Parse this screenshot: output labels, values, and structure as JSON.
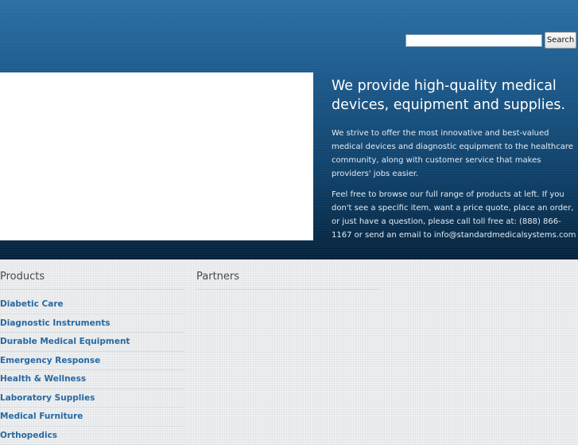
{
  "search": {
    "value": "",
    "button_label": "Search"
  },
  "hero": {
    "headline": "We provide high-quality medical devices, equipment and supplies.",
    "paragraph1": "We strive to offer the most innovative and best-valued medical devices and diagnostic equipment to the healthcare community, along with customer service that makes providers' jobs easier.",
    "paragraph2": "Feel free to browse our full range of products at left. If you don't see a specific item, want a price quote, place an order, or just have a question, please call toll free at: (888) 866-1167 or send an email to info@standardmedicalsystems.com"
  },
  "products": {
    "title": "Products",
    "items": [
      {
        "label": "Diabetic Care"
      },
      {
        "label": "Diagnostic Instruments"
      },
      {
        "label": "Durable Medical Equipment"
      },
      {
        "label": "Emergency Response"
      },
      {
        "label": "Health & Wellness"
      },
      {
        "label": "Laboratory Supplies"
      },
      {
        "label": "Medical Furniture"
      },
      {
        "label": "Orthopedics"
      }
    ]
  },
  "partners": {
    "title": "Partners"
  },
  "colors": {
    "link": "#2869a3",
    "hero_top": "#2c6fa5",
    "hero_bottom": "#06233d"
  }
}
